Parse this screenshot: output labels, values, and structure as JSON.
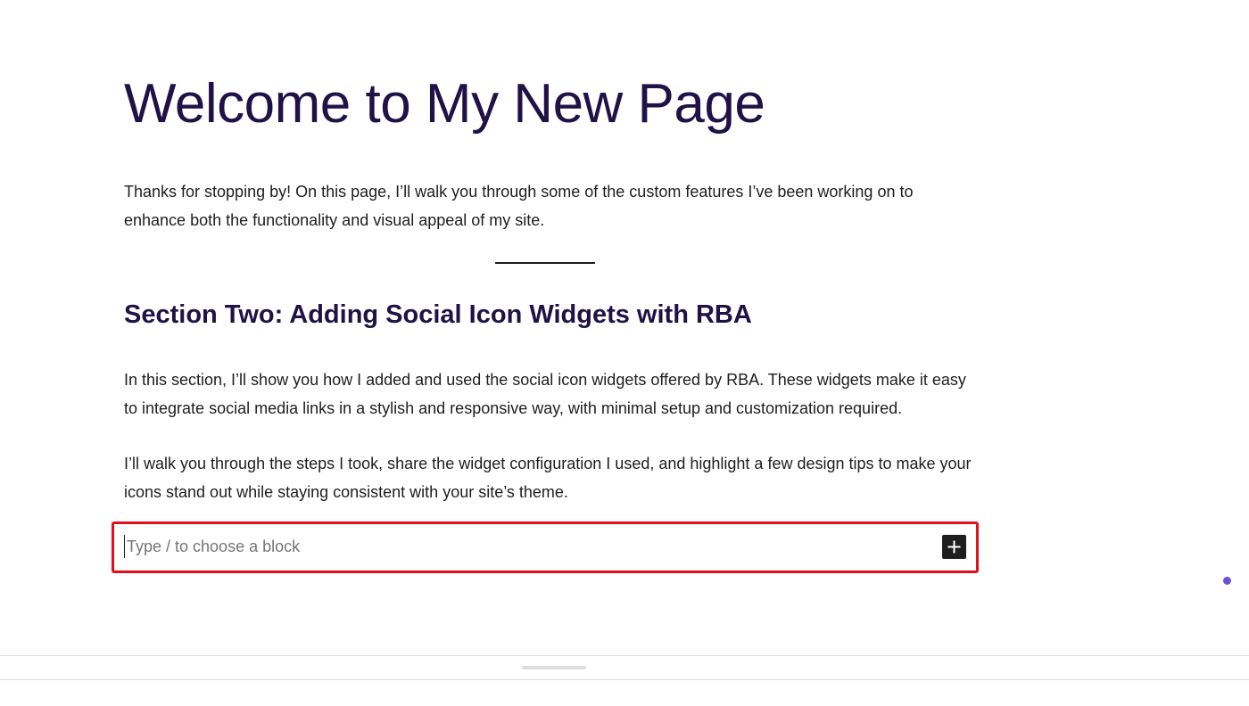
{
  "page": {
    "title": "Welcome to My New Page",
    "intro_paragraph": "Thanks for stopping by! On this page, I’ll walk you through some of the custom features I’ve been working on to enhance both the functionality and visual appeal of my site.",
    "section_heading": "Section Two: Adding Social Icon Widgets with RBA",
    "paragraph_2": "In this section, I’ll show you how I added and used the social icon widgets offered by RBA. These widgets make it easy to integrate social media links in a stylish and responsive way, with minimal setup and customization required.",
    "paragraph_3": "I’ll walk you through the steps I took, share the widget configuration I used, and highlight a few design tips to make your icons stand out while staying consistent with your site’s theme."
  },
  "block_appender": {
    "placeholder": "Type / to choose a block",
    "value": "",
    "add_icon": "plus-icon",
    "highlight_color": "#e1101c"
  },
  "colors": {
    "heading": "#1f1246",
    "body_text": "#1e1e1e",
    "status_dot": "#6a4fd8"
  }
}
